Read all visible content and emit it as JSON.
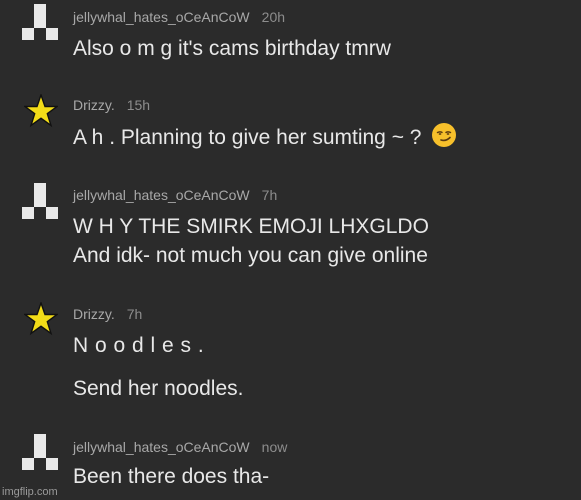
{
  "comments": [
    {
      "user": "jellywhal_hates_oCeAnCoW",
      "time": "20h",
      "avatar": "checker-avatar-icon",
      "lines": [
        "Also o m g it's cams birthday tmrw"
      ]
    },
    {
      "user": "Drizzy.",
      "time": "15h",
      "avatar": "star-avatar-icon",
      "lines": [
        "A h . Planning to give her sumting ~ ?"
      ],
      "emoji": "smirk-emoji-icon"
    },
    {
      "user": "jellywhal_hates_oCeAnCoW",
      "time": "7h",
      "avatar": "checker-avatar-icon",
      "lines": [
        "W H Y THE SMIRK EMOJI LHXGLDO",
        "And idk- not much you can give online"
      ]
    },
    {
      "user": "Drizzy.",
      "time": "7h",
      "avatar": "star-avatar-icon",
      "lines": [
        "N o o d l e s .",
        "Send her noodles."
      ]
    },
    {
      "user": "jellywhal_hates_oCeAnCoW",
      "time": "now",
      "avatar": "checker-avatar-icon",
      "lines": [
        "Been there does tha-"
      ]
    }
  ],
  "watermark": "imgflip.com",
  "colors": {
    "background": "#2b2b2b",
    "star": "#f2dc18",
    "checker": "#e9e9e9"
  }
}
